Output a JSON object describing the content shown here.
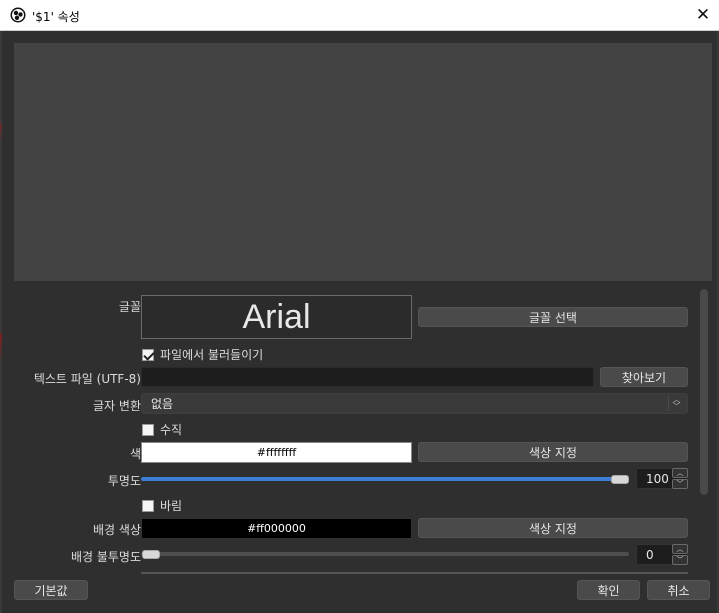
{
  "window": {
    "title": "'$1' 속성",
    "close_icon": "close-icon"
  },
  "properties": {
    "font": {
      "label": "글꼴",
      "preview": "Arial",
      "select_button": "글꼴 선택"
    },
    "read_from_file": {
      "label": "파일에서 불러들이기",
      "checked": true
    },
    "text_file": {
      "label": "텍스트 파일 (UTF-8)",
      "value": "",
      "browse_button": "찾아보기"
    },
    "text_transform": {
      "label": "글자 변환",
      "selected": "없음"
    },
    "vertical": {
      "label": "수직",
      "checked": false
    },
    "color": {
      "label": "색",
      "value": "#ffffffff",
      "button": "색상 지정",
      "swatch": "#ffffff"
    },
    "opacity": {
      "label": "투명도",
      "value": "100",
      "fraction": 1.0
    },
    "gradient": {
      "label": "바림",
      "checked": false
    },
    "bg_color": {
      "label": "배경 색상",
      "value": "#ff000000",
      "button": "색상 지정",
      "swatch": "#000000"
    },
    "bg_opacity": {
      "label": "배경 불투명도",
      "value": "0",
      "fraction": 0.0
    }
  },
  "footer": {
    "defaults_button": "기본값",
    "ok_button": "확인",
    "cancel_button": "취소"
  },
  "colors": {
    "accent": "#3c7fd4",
    "background": "#2f2f2f",
    "preview": "#434343"
  }
}
